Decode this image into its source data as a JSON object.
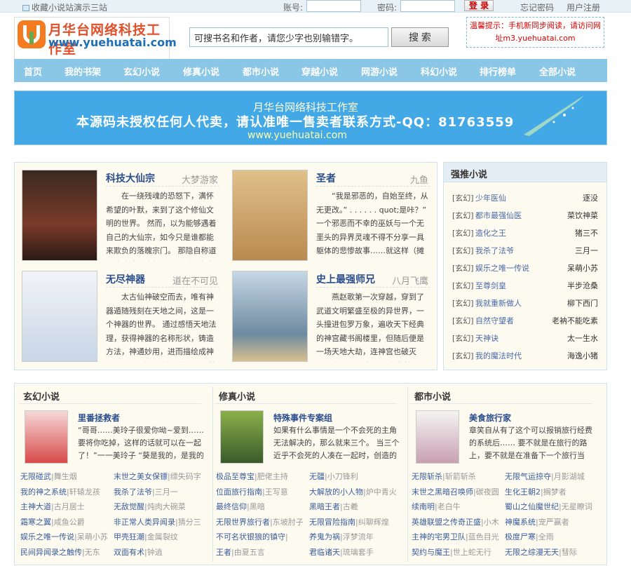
{
  "topbar": {
    "fav": "收藏小说站演示三站",
    "account_label": "账号:",
    "password_label": "密码:",
    "login": "登 录",
    "forgot": "忘记密码",
    "register": "用户注册"
  },
  "logo": {
    "cn": "月华台网络科技工作室",
    "url": "www.yuehuatai.com"
  },
  "search": {
    "placeholder": "可搜书名和作者，请您少字也别输错字。",
    "button": "搜 索"
  },
  "tip": {
    "line1": "温馨提示：手机新同步阅读，请访问网",
    "line2": "址m3.yuehuatai.com"
  },
  "nav": [
    "首页",
    "我的书架",
    "玄幻小说",
    "修真小说",
    "都市小说",
    "穿越小说",
    "网游小说",
    "科幻小说",
    "排行榜单",
    "全部小说"
  ],
  "banner": {
    "line1": "月华台网络科技工作室",
    "line2": "本源码未授权任何人代卖，请认准唯一售卖者联系方式-QQ：81763559",
    "line3": "www.yuehuatai.com"
  },
  "featured": [
    {
      "title": "科技大仙宗",
      "author": "大梦游家",
      "desc": "在一绕残魂的恐怒下，满怀希望的叶默，来到了这个修仙文明的世界。 然而，以为能够遇着自己的大仙宗，如今只是谁都能来欺负的落魄宗门。 那隐自称道祖的残魂，也拐不到了重塑肉身的精血。 “好",
      "cover_color": "#5a3a2a"
    },
    {
      "title": "圣者",
      "author": "九鱼",
      "desc": "“我是邪恶的，自始至终，从无更改。” . . . . . . quot;是咔？” 一个邪恶而不幸的巫妖与一个无垩头的异界灵魂不得不分享一具躯体的悲惨故事……就这样（摊手）。 . . .",
      "cover_color": "#c9a066"
    },
    {
      "title": "无尽神器",
      "author": "道在不可见",
      "desc": "太古仙神破空而去，唯有神器遁随残刻在天地之间，这是一个神器的世界。 通过感悟天地法理，获得神器的名称形状，铸造方法，神通妙用，进而描绘成神器谱。 通过沟通神兵谱，可以将自身法力凝炼",
      "cover_color": "#e8eef4"
    },
    {
      "title": "史上最强师兄",
      "author": "八月飞鹰",
      "desc": "燕赵歌第一次穿越，穿到了武道文明繁盛至极的异世界，一头撞进包罗万象，遍收天下经典的神宫藏书阁楼里，但随后便是一场天地大劫，连神宫也破灭了。 接下来居然第二次穿越，灵魂来到了同一个世",
      "cover_color": "#9fb7c9"
    }
  ],
  "side": {
    "title": "强推小说",
    "items": [
      {
        "cat": "[玄幻]",
        "book": "少年医仙",
        "author": "逐没"
      },
      {
        "cat": "[玄幻]",
        "book": "都市最强仙医",
        "author": "菜饮神菜"
      },
      {
        "cat": "[玄幻]",
        "book": "造化之王",
        "author": "猪三不"
      },
      {
        "cat": "[玄幻]",
        "book": "我杀了法爷",
        "author": "三月一"
      },
      {
        "cat": "[玄幻]",
        "book": "娱乐之唯一传说",
        "author": "呆萌小苏"
      },
      {
        "cat": "[玄幻]",
        "book": "至尊剑皇",
        "author": "半步沧桑"
      },
      {
        "cat": "[玄幻]",
        "book": "我就重新做人",
        "author": "柳下西门"
      },
      {
        "cat": "[玄幻]",
        "book": "自然守望者",
        "author": "老衲不能吃素"
      },
      {
        "cat": "[玄幻]",
        "book": "天神诀",
        "author": "太一生水"
      },
      {
        "cat": "[玄幻]",
        "book": "我的魔法时代",
        "author": "海逸小猪"
      }
    ]
  },
  "cols": [
    {
      "title": "玄幻小说",
      "ftitle": "里番拯救者",
      "fdesc": "“哥哥……美玲子很爱你呦~爱到……要将你吃掉，这样的话就可以在一起了！”一一美玲子 “葵是我的，是我的",
      "list": [
        [
          "无限碰武",
          "舞生烟",
          "末世之美女保镖",
          "缥失码字"
        ],
        [
          "我的神之系统",
          "轩辕龙孩",
          "我杀了法爷",
          "三月一"
        ],
        [
          "主神大道",
          "古月居士",
          "无敌觉醒",
          "炖肉大碗菜"
        ],
        [
          "霜寒之翼",
          "咸鱼公爵",
          "非正常人类异闻录",
          "猜分三"
        ],
        [
          "娱乐之唯一传说",
          "呆萌小苏",
          "甲壳狂潮",
          "金属裂纹"
        ],
        [
          "民间异闻录之触传",
          "无东",
          "双面有术",
          "钟逍"
        ]
      ]
    },
    {
      "title": "修真小说",
      "ftitle": "特殊事件专案组",
      "fdesc": "如果有什么事情是一个不会死的主角无法解决的，那么就来三个。 当三个近乎不会死的人凑在一起时，创造的奇迹其实远",
      "list": [
        [
          "极品至尊宝",
          "肥佬主持",
          "无疆",
          "小刀锋利"
        ],
        [
          "位面旅行指南",
          "王写意",
          "大解放的小人物",
          "炉中青火"
        ],
        [
          "最终信仰",
          "黑暗",
          "黑暗王者",
          "古羲"
        ],
        [
          "无限世界旅行者",
          "东坡肘子",
          "无限冒险指南",
          "纠聊辉煌"
        ],
        [
          "不可名状银狼的镇守",
          "",
          "养鬼为祸",
          "浮梦流年"
        ],
        [
          "王者",
          "由夏五言",
          "君临诸天",
          "琉璃套手"
        ]
      ]
    },
    {
      "title": "都市小说",
      "ftitle": "美食旅行家",
      "fdesc": "章笑自从有了这个可以报销旅行经费的系统后…… 要不就是在旅行的路上，要不就是在准备下一个旅行当中。 住过几十",
      "list": [
        [
          "无限斩杀",
          "斩箭斩杀",
          "无限气运掠夺",
          "月影湖城"
        ],
        [
          "末世之黑暗召唤师",
          "碳夜圆",
          "生化王朝2",
          "搁梦者"
        ],
        [
          "续南明",
          "老白牛",
          "蜀山之仙魔世纪",
          "无星瞭词"
        ],
        [
          "英雄联盟之传奇正盛",
          "小木",
          "神魔系统",
          "宠严赢者"
        ],
        [
          "主神的宅男卫队",
          "蓝色目光",
          "极度尸寒",
          "全雨"
        ],
        [
          "契约与魔王",
          "世上蛇无行",
          "无限之综漫无天",
          "彗际"
        ]
      ]
    }
  ]
}
